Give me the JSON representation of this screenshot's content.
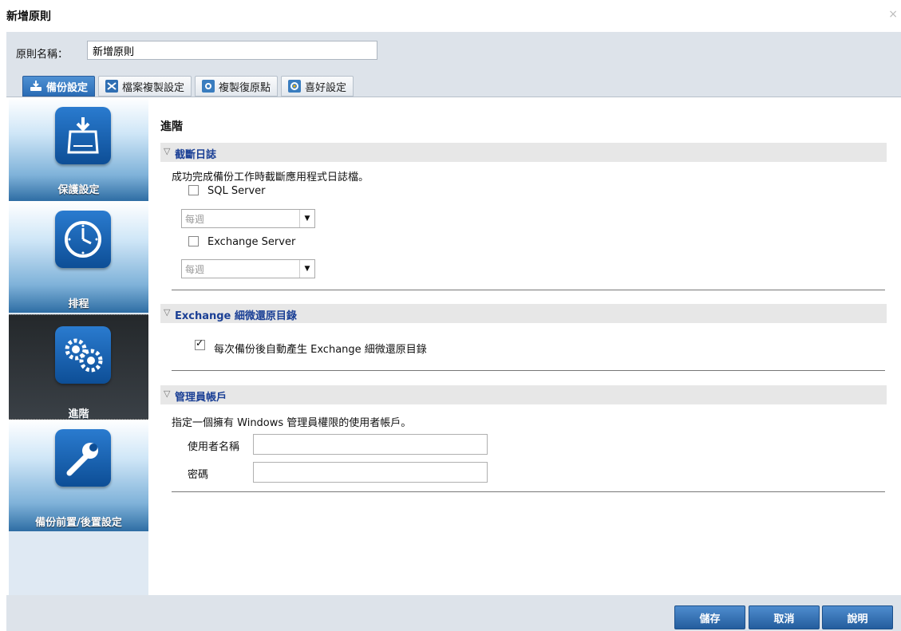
{
  "window": {
    "title": "新增原則",
    "close": "×"
  },
  "policy": {
    "name_label": "原則名稱：",
    "name_value": "新增原則"
  },
  "tabs": [
    {
      "label": "備份設定",
      "active": true,
      "icon": "backup-icon"
    },
    {
      "label": "檔案複製設定",
      "active": false,
      "icon": "file-copy-icon"
    },
    {
      "label": "複製復原點",
      "active": false,
      "icon": "copy-recovery-point-icon"
    },
    {
      "label": "喜好設定",
      "active": false,
      "icon": "preferences-icon"
    }
  ],
  "sidebar": {
    "items": [
      {
        "label": "保護設定",
        "icon": "disk-download-icon",
        "active": false
      },
      {
        "label": "排程",
        "icon": "clock-icon",
        "active": false
      },
      {
        "label": "進階",
        "icon": "gears-icon",
        "active": true
      },
      {
        "label": "備份前置/後置設定",
        "icon": "wrench-icon",
        "active": false
      }
    ]
  },
  "content": {
    "heading": "進階",
    "truncate": {
      "title": "截斷日誌",
      "description": "成功完成備份工作時截斷應用程式日誌檔。",
      "sql_label": "SQL Server",
      "sql_checked": false,
      "sql_frequency": "每週",
      "exchange_label": "Exchange Server",
      "exchange_checked": false,
      "exchange_frequency": "每週"
    },
    "exchange_catalog": {
      "title": "Exchange 細微還原目錄",
      "option_label": "每次備份後自動產生 Exchange 細微還原目錄",
      "option_checked": true
    },
    "admin": {
      "title": "管理員帳戶",
      "description": "指定一個擁有 Windows 管理員權限的使用者帳戶。",
      "username_label": "使用者名稱",
      "username_value": "",
      "password_label": "密碼",
      "password_value": ""
    }
  },
  "footer": {
    "save": "儲存",
    "cancel": "取消",
    "help": "說明"
  },
  "colors": {
    "accent": "#2a6cb5",
    "section_title": "#1a3f95",
    "sidebar_active": "#2b3035"
  }
}
